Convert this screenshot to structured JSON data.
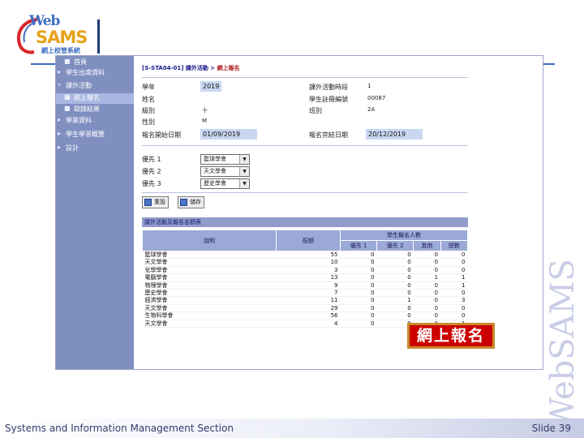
{
  "logo": {
    "web": "Web",
    "sams": "SAMS",
    "subtitle": "網上校管系統"
  },
  "watermark": "WebSAMS",
  "nav": {
    "items": [
      {
        "label": "首頁",
        "mark": "■",
        "indent": 1,
        "active": false
      },
      {
        "label": "學生出席資料",
        "mark": "▸",
        "indent": 0,
        "active": false
      },
      {
        "label": "課外活動",
        "mark": "▿",
        "indent": 0,
        "active": false
      },
      {
        "label": "網上報名",
        "mark": "■",
        "indent": 1,
        "active": true
      },
      {
        "label": "取錄結果",
        "mark": "■",
        "indent": 1,
        "active": false
      },
      {
        "label": "學業資料",
        "mark": "▸",
        "indent": 0,
        "active": false
      },
      {
        "label": "學生學習概覽",
        "mark": "▸",
        "indent": 0,
        "active": false
      },
      {
        "label": "設計",
        "mark": "▸",
        "indent": 0,
        "active": false
      }
    ]
  },
  "breadcrumb": {
    "code": "[S-STA04-01]",
    "path": "課外活動 > ",
    "current": "網上報名"
  },
  "form": {
    "year_label": "學年",
    "year_value": "2019",
    "name_label": "姓名",
    "name_value": "",
    "level_label": "級別",
    "level_value": "十",
    "status_label": "性別",
    "status_value": "M",
    "start_label": "報名開始日期",
    "start_prefix": "01/09/",
    "start_value": "2019",
    "period_label": "課外活動時段",
    "period_value": "1",
    "regno_label": "學生註冊編號",
    "regno_value": "00087",
    "class_label": "班別",
    "class_value": "2A",
    "end_label": "報名完結日期",
    "end_prefix": "20/12/",
    "end_value": "2019"
  },
  "choices": [
    {
      "label": "優先 1",
      "value": "籃球學會"
    },
    {
      "label": "優先 2",
      "value": "天文學會"
    },
    {
      "label": "優先 3",
      "value": "歷史學會"
    }
  ],
  "buttons": {
    "reset": "重設",
    "save": "儲存"
  },
  "panel": {
    "title": "課外活動及報名名額表",
    "headers": {
      "desc": "說明",
      "quota": "配額",
      "group": "學生報名人數",
      "p1": "優先 1",
      "p2": "優先 2",
      "other": "其他",
      "total": "總數"
    },
    "rows": [
      {
        "name": "籃球學會",
        "quota": "55",
        "p1": "0",
        "p2": "0",
        "other": "0",
        "total": "0"
      },
      {
        "name": "天文學會",
        "quota": "10",
        "p1": "0",
        "p2": "0",
        "other": "0",
        "total": "0"
      },
      {
        "name": "化學學會",
        "quota": "3",
        "p1": "0",
        "p2": "0",
        "other": "0",
        "total": "0"
      },
      {
        "name": "電腦學會",
        "quota": "13",
        "p1": "0",
        "p2": "0",
        "other": "1",
        "total": "1"
      },
      {
        "name": "物理學會",
        "quota": "9",
        "p1": "0",
        "p2": "0",
        "other": "0",
        "total": "1"
      },
      {
        "name": "歷史學會",
        "quota": "7",
        "p1": "0",
        "p2": "0",
        "other": "0",
        "total": "0"
      },
      {
        "name": "經濟學會",
        "quota": "11",
        "p1": "0",
        "p2": "1",
        "other": "0",
        "total": "3"
      },
      {
        "name": "天文學會",
        "quota": "29",
        "p1": "0",
        "p2": "0",
        "other": "0",
        "total": "0"
      },
      {
        "name": "生物科學會",
        "quota": "56",
        "p1": "0",
        "p2": "0",
        "other": "0",
        "total": "0"
      },
      {
        "name": "天文學會",
        "quota": "4",
        "p1": "0",
        "p2": "0",
        "other": "0",
        "total": "1"
      }
    ]
  },
  "callout": "網上報名",
  "footer": {
    "left": "Systems and Information Management Section",
    "right": "Slide 39"
  }
}
